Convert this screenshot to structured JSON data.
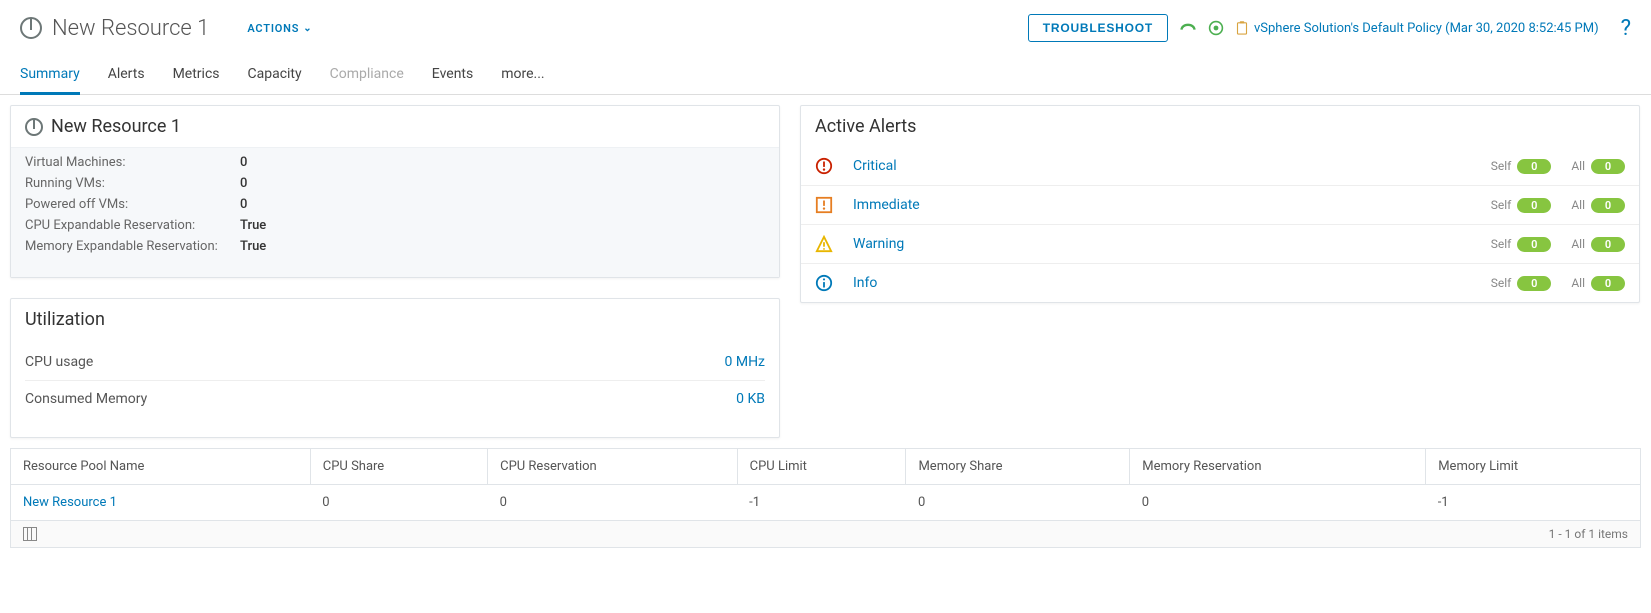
{
  "header": {
    "title": "New Resource 1",
    "actions_label": "ACTIONS",
    "troubleshoot_label": "TROUBLESHOOT",
    "policy_text": "vSphere Solution's Default Policy (Mar 30, 2020 8:52:45 PM)"
  },
  "tabs": [
    {
      "label": "Summary",
      "state": "active"
    },
    {
      "label": "Alerts",
      "state": ""
    },
    {
      "label": "Metrics",
      "state": ""
    },
    {
      "label": "Capacity",
      "state": ""
    },
    {
      "label": "Compliance",
      "state": "disabled"
    },
    {
      "label": "Events",
      "state": ""
    },
    {
      "label": "more...",
      "state": ""
    }
  ],
  "summary_card": {
    "title": "New Resource 1",
    "props": [
      {
        "label": "Virtual Machines:",
        "value": "0"
      },
      {
        "label": "Running VMs:",
        "value": "0"
      },
      {
        "label": "Powered off VMs:",
        "value": "0"
      },
      {
        "label": "CPU Expandable Reservation:",
        "value": "True"
      },
      {
        "label": "Memory Expandable Reservation:",
        "value": "True"
      }
    ]
  },
  "alerts_card": {
    "title": "Active Alerts",
    "self_label": "Self",
    "all_label": "All",
    "rows": [
      {
        "name": "Critical",
        "color": "#c92100",
        "self": "0",
        "all": "0"
      },
      {
        "name": "Immediate",
        "color": "#e67e22",
        "self": "0",
        "all": "0"
      },
      {
        "name": "Warning",
        "color": "#f2c94c",
        "self": "0",
        "all": "0"
      },
      {
        "name": "Info",
        "color": "#0079b8",
        "self": "0",
        "all": "0"
      }
    ]
  },
  "util_card": {
    "title": "Utilization",
    "rows": [
      {
        "label": "CPU usage",
        "value": "0 MHz"
      },
      {
        "label": "Consumed Memory",
        "value": "0 KB"
      }
    ]
  },
  "table": {
    "columns": [
      "Resource Pool Name",
      "CPU Share",
      "CPU Reservation",
      "CPU Limit",
      "Memory Share",
      "Memory Reservation",
      "Memory Limit"
    ],
    "rows": [
      {
        "name": "New Resource 1",
        "cpu_share": "0",
        "cpu_res": "0",
        "cpu_limit": "-1",
        "mem_share": "0",
        "mem_res": "0",
        "mem_limit": "-1"
      }
    ],
    "footer": "1 - 1 of 1 items"
  }
}
